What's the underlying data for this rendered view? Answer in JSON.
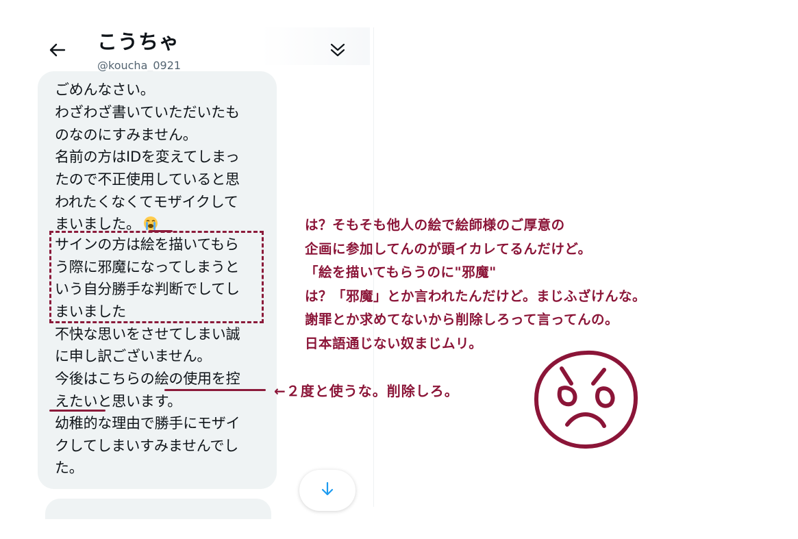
{
  "header": {
    "title": "こうちゃ",
    "handle": "@koucha_0921"
  },
  "message": {
    "lines": [
      "ごめんなさい。",
      "わざわざ書いていただいたも",
      "のなのにすみません。",
      "名前の方はIDを変えてしまっ",
      "たので不正使用していると思",
      "われたくなくてモザイクして",
      "まいました。",
      "サインの方は絵を描いてもら",
      "う際に邪魔になってしまうと",
      "いう自分勝手な判断でしてし",
      "まいました",
      "不快な思いをさせてしまい誠",
      "に申し訳ございません。",
      "今後はこちらの絵の使用を控",
      "えたいと思います。",
      "幼稚的な理由で勝手にモザイ",
      "クしてしまいすみませんでし",
      "た。"
    ],
    "emoji": "loudly-crying-face-icon"
  },
  "annotation": {
    "comment_lines": [
      "は？そもそも他人の絵で絵師様のご厚意の",
      "企画に参加してんのが頭イカレてるんだけど。",
      "「絵を描いてもらうのに\"邪魔\"",
      "は？「邪魔」とか言われたんだけど。まじふざけんな。",
      "謝罪とか求めてないから削除しろって言ってんの。",
      "日本語通じない奴まじムリ。"
    ],
    "arrow_note": "←２度と使うな。削除しろ。",
    "accent_color": "#8b1538"
  },
  "icons": {
    "back": "back-arrow-icon",
    "expand": "double-chevron-down-icon",
    "scroll": "arrow-down-icon",
    "face": "angry-face-icon"
  }
}
